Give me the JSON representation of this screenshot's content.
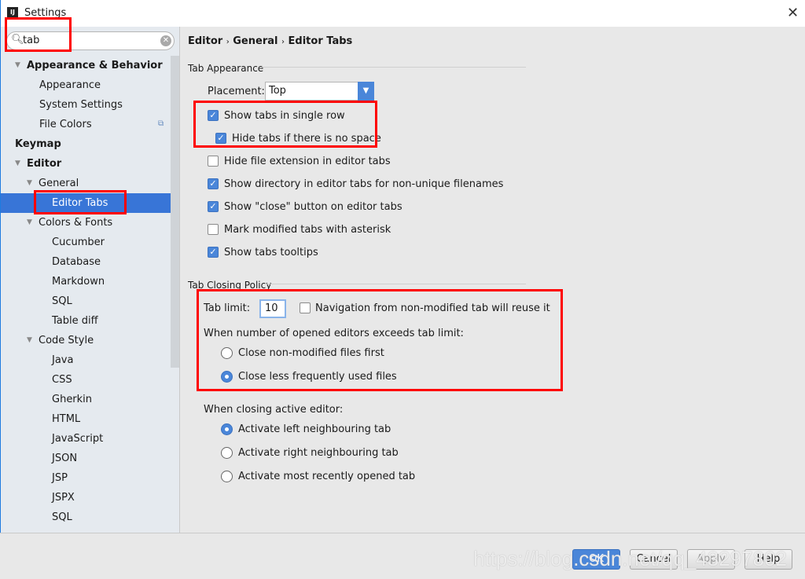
{
  "window": {
    "title": "Settings",
    "logo": "IJ",
    "close_icon": "close-icon"
  },
  "search": {
    "value": "tab"
  },
  "sidebar": {
    "items": [
      {
        "label": "Appearance & Behavior",
        "bold": true,
        "expanded": true
      },
      {
        "label": "Appearance"
      },
      {
        "label": "System Settings"
      },
      {
        "label": "File Colors"
      },
      {
        "label": "Keymap",
        "bold": true
      },
      {
        "label": "Editor",
        "bold": true,
        "expanded": true
      },
      {
        "label": "General",
        "expanded": true
      },
      {
        "label": "Editor Tabs",
        "selected": true
      },
      {
        "label": "Colors & Fonts",
        "expanded": true
      },
      {
        "label": "Cucumber"
      },
      {
        "label": "Database"
      },
      {
        "label": "Markdown"
      },
      {
        "label": "SQL"
      },
      {
        "label": "Table diff"
      },
      {
        "label": "Code Style",
        "expanded": true
      },
      {
        "label": "Java"
      },
      {
        "label": "CSS"
      },
      {
        "label": "Gherkin"
      },
      {
        "label": "HTML"
      },
      {
        "label": "JavaScript"
      },
      {
        "label": "JSON"
      },
      {
        "label": "JSP"
      },
      {
        "label": "JSPX"
      },
      {
        "label": "SQL"
      }
    ]
  },
  "breadcrumb": [
    "Editor",
    "General",
    "Editor Tabs"
  ],
  "tab_appearance": {
    "heading": "Tab Appearance",
    "placement_label": "Placement:",
    "placement_value": "Top",
    "options": [
      {
        "label": "Show tabs in single row",
        "checked": true
      },
      {
        "label": "Hide tabs if there is no space",
        "checked": true
      },
      {
        "label": "Hide file extension in editor tabs",
        "checked": false
      },
      {
        "label": "Show directory in editor tabs for non-unique filenames",
        "checked": true
      },
      {
        "label": "Show \"close\" button on editor tabs",
        "checked": true
      },
      {
        "label": "Mark modified tabs with asterisk",
        "checked": false
      },
      {
        "label": "Show tabs tooltips",
        "checked": true
      }
    ]
  },
  "tab_closing": {
    "heading": "Tab Closing Policy",
    "tab_limit_label": "Tab limit:",
    "tab_limit_value": "10",
    "navigation_label": "Navigation from non-modified tab will reuse it",
    "navigation_checked": false,
    "exceeds_label": "When number of opened editors exceeds tab limit:",
    "exceeds_options": [
      {
        "label": "Close non-modified files first",
        "selected": false
      },
      {
        "label": "Close less frequently used files",
        "selected": true
      }
    ],
    "closing_label": "When closing active editor:",
    "closing_options": [
      {
        "label": "Activate left neighbouring tab",
        "selected": true
      },
      {
        "label": "Activate right neighbouring tab",
        "selected": false
      },
      {
        "label": "Activate most recently opened tab",
        "selected": false
      }
    ]
  },
  "buttons": {
    "ok": "OK",
    "cancel": "Cancel",
    "apply": "Apply",
    "help": "Help"
  },
  "watermark": "https://blog.csdn.net/qq_43297802",
  "colors": {
    "accent": "#4a86d9",
    "selection": "#3875d7",
    "annotation": "#ff0000"
  }
}
